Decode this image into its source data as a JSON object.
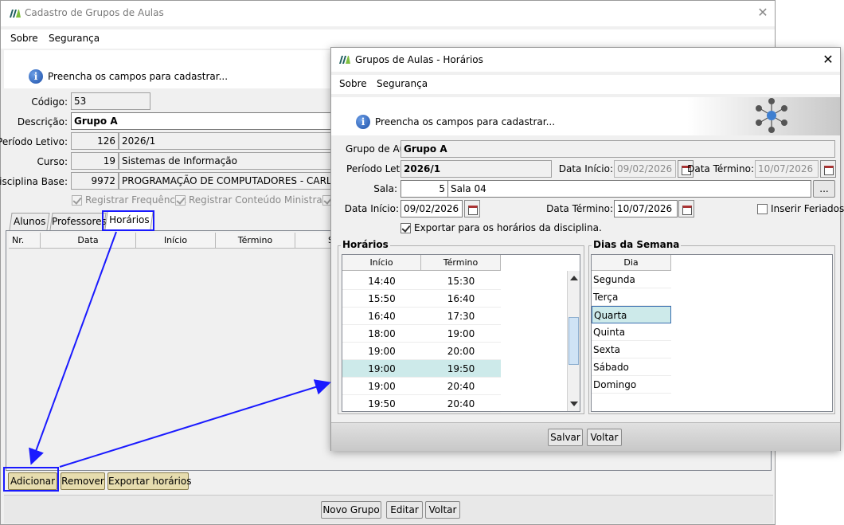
{
  "main_window": {
    "title": "Cadastro de Grupos de Aulas",
    "close_glyph": "✕",
    "menu": [
      "Sobre",
      "Segurança"
    ],
    "info_text": "Preencha os campos para cadastrar...",
    "fields": {
      "codigo_label": "Código:",
      "codigo_value": "53",
      "descricao_label": "Descrição:",
      "descricao_value": "Grupo A",
      "periodo_label": "Período Letivo:",
      "periodo_id": "126",
      "periodo_value": "2026/1",
      "curso_label": "Curso:",
      "curso_id": "19",
      "curso_value": "Sistemas de Informação",
      "disciplina_label": "Disciplina Base:",
      "disciplina_id": "9972",
      "disciplina_value": "PROGRAMAÇÃO DE COMPUTADORES - CARLOS I"
    },
    "checkboxes": [
      "Registrar Frequência.",
      "Registrar Conteúdo Ministrado."
    ],
    "tabs": [
      "Alunos",
      "Professores",
      "Horários"
    ],
    "grid_headers": [
      "Nr.",
      "Data",
      "Início",
      "Término",
      "S"
    ],
    "bottom_buttons": [
      "Adicionar",
      "Remover",
      "Exportar horários"
    ],
    "footer_buttons": [
      "Novo Grupo",
      "Editar",
      "Voltar"
    ]
  },
  "dialog": {
    "title": "Grupos de Aulas - Horários",
    "close_glyph": "✕",
    "menu": [
      "Sobre",
      "Segurança"
    ],
    "info_text": "Preencha os campos para cadastrar...",
    "grupo_label": "Grupo de Aula:",
    "grupo_value": "Grupo A",
    "periodo_label": "Período Letivo:",
    "periodo_value": "2026/1",
    "periodo_inicio_label": "Data Início:",
    "periodo_inicio_value": "09/02/2026",
    "periodo_termino_label": "Data Término:",
    "periodo_termino_value": "10/07/2026",
    "sala_label": "Sala:",
    "sala_id": "5",
    "sala_value": "Sala 04",
    "sala_btn": "...",
    "inicio_label": "Data Início:",
    "inicio_value": "09/02/2026",
    "termino_label": "Data Término:",
    "termino_value": "10/07/2026",
    "feriados_label": "Inserir Feriados",
    "exportar_label": "Exportar para os horários da disciplina.",
    "horarios_title": "Horários",
    "horarios_headers": [
      "Início",
      "Término"
    ],
    "horarios_rows": [
      [
        "14:40",
        "15:30"
      ],
      [
        "15:50",
        "16:40"
      ],
      [
        "16:40",
        "17:30"
      ],
      [
        "18:00",
        "19:00"
      ],
      [
        "19:00",
        "20:00"
      ],
      [
        "19:00",
        "19:50"
      ],
      [
        "19:00",
        "20:40"
      ],
      [
        "19:50",
        "20:40"
      ]
    ],
    "horarios_selected_index": 5,
    "dias_title": "Dias da Semana",
    "dias_header": "Dia",
    "dias_rows": [
      "Segunda",
      "Terça",
      "Quarta",
      "Quinta",
      "Sexta",
      "Sábado",
      "Domingo"
    ],
    "dias_selected_index": 2,
    "buttons": [
      "Salvar",
      "Voltar"
    ]
  },
  "colors": {
    "annotation": "#1a1aff",
    "selection": "#cdeaea",
    "button_gold": "#e6dcae"
  }
}
